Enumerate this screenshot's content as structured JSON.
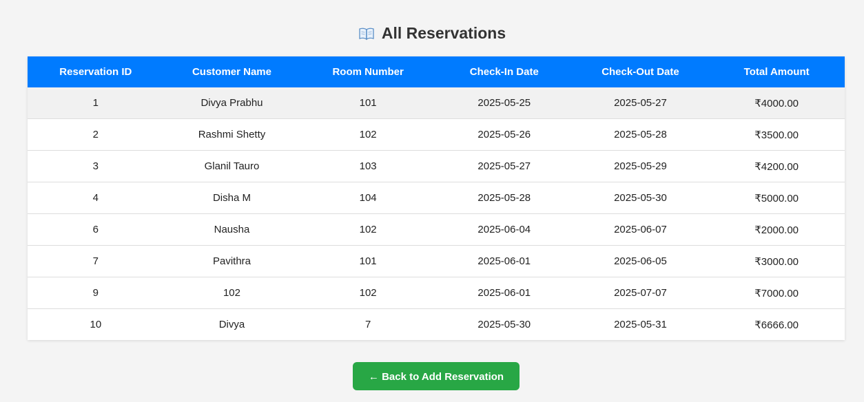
{
  "page": {
    "title": "All Reservations",
    "title_icon": "open-book-icon"
  },
  "table": {
    "headers": [
      "Reservation ID",
      "Customer Name",
      "Room Number",
      "Check-In Date",
      "Check-Out Date",
      "Total Amount"
    ],
    "rows": [
      [
        "1",
        "Divya Prabhu",
        "101",
        "2025-05-25",
        "2025-05-27",
        "₹4000.00"
      ],
      [
        "2",
        "Rashmi Shetty",
        "102",
        "2025-05-26",
        "2025-05-28",
        "₹3500.00"
      ],
      [
        "3",
        "Glanil Tauro",
        "103",
        "2025-05-27",
        "2025-05-29",
        "₹4200.00"
      ],
      [
        "4",
        "Disha M",
        "104",
        "2025-05-28",
        "2025-05-30",
        "₹5000.00"
      ],
      [
        "6",
        "Nausha",
        "102",
        "2025-06-04",
        "2025-06-07",
        "₹2000.00"
      ],
      [
        "7",
        "Pavithra",
        "101",
        "2025-06-01",
        "2025-06-05",
        "₹3000.00"
      ],
      [
        "9",
        "102",
        "102",
        "2025-06-01",
        "2025-07-07",
        "₹7000.00"
      ],
      [
        "10",
        "Divya",
        "7",
        "2025-05-30",
        "2025-05-31",
        "₹6666.00"
      ]
    ]
  },
  "back_button": {
    "label": "← Back to Add Reservation"
  },
  "colors": {
    "header_bg": "#007bff",
    "button_bg": "#28a745",
    "page_bg": "#f4f4f4"
  }
}
